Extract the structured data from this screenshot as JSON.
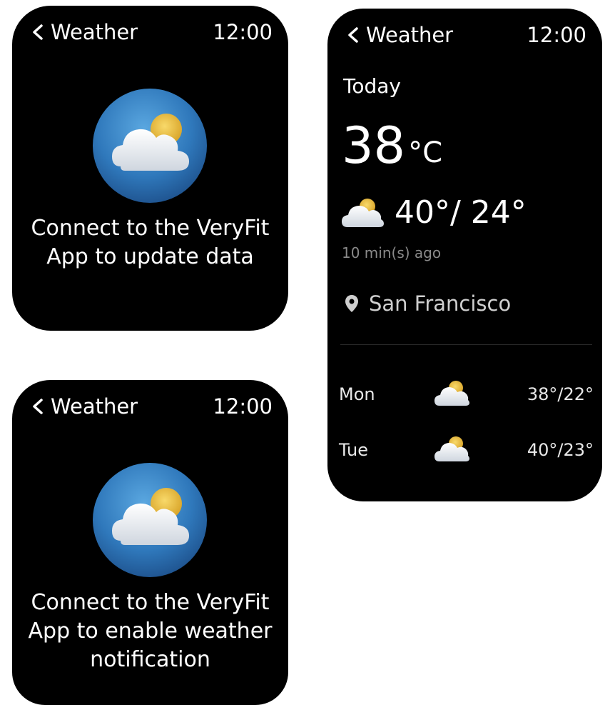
{
  "screens": {
    "connect_update": {
      "back_label": "Weather",
      "time": "12:00",
      "icon": "cloud-sun-icon",
      "message": "Connect to the VeryFit App to update data"
    },
    "connect_enable": {
      "back_label": "Weather",
      "time": "12:00",
      "icon": "cloud-sun-icon",
      "message": "Connect to the VeryFit App to enable weather notification"
    },
    "weather_detail": {
      "back_label": "Weather",
      "time": "12:00",
      "today_label": "Today",
      "current_temp": "38",
      "unit": "°C",
      "high_low": "40°/ 24°",
      "updated": "10 min(s) ago",
      "location": "San Francisco",
      "forecast": [
        {
          "day": "Mon",
          "icon": "cloud-sun-icon",
          "high_low": "38°/22°"
        },
        {
          "day": "Tue",
          "icon": "cloud-sun-icon",
          "high_low": "40°/23°"
        }
      ]
    }
  },
  "colors": {
    "background": "#000000",
    "text": "#ffffff",
    "muted": "#8a8a8a",
    "icon_circle": "#2f7fc1",
    "sun": "#f0c33a"
  }
}
